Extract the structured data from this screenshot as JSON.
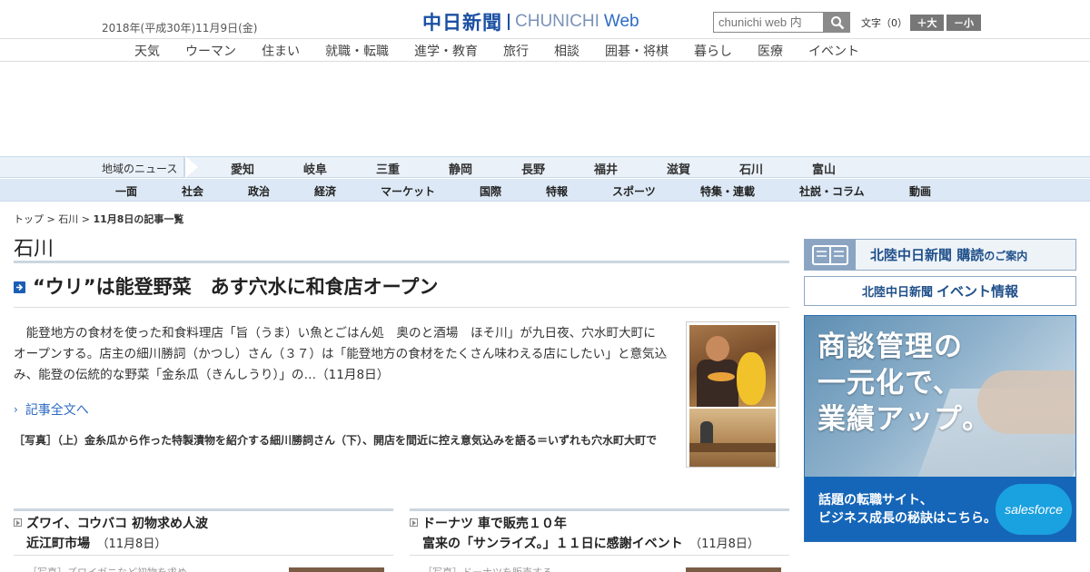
{
  "header": {
    "date": "2018年(平成30年)11月9日(金)",
    "logo_ja": "中日新聞",
    "logo_en": "CHUNICHI",
    "logo_web": "Web",
    "search_placeholder": "chunichi web 内",
    "textsize_label": "文字（0）",
    "bigger_label": "＋大",
    "smaller_label": "－小"
  },
  "topnav": [
    "天気",
    "ウーマン",
    "住まい",
    "就職・転職",
    "進学・教育",
    "旅行",
    "相談",
    "囲碁・将棋",
    "暮らし",
    "医療",
    "イベント"
  ],
  "region": {
    "label": "地域のニュース",
    "prefs": [
      "愛知",
      "岐阜",
      "三重",
      "静岡",
      "長野",
      "福井",
      "滋賀",
      "石川",
      "富山"
    ]
  },
  "sections": [
    "一面",
    "社会",
    "政治",
    "経済",
    "マーケット",
    "国際",
    "特報",
    "スポーツ",
    "特集・連載",
    "社説・コラム",
    "動画"
  ],
  "breadcrumb": {
    "top": "トップ",
    "sep": " > ",
    "region": "石川",
    "current": "11月8日の記事一覧"
  },
  "page_title": "石川",
  "article": {
    "headline": "“ウリ”は能登野菜　あす穴水に和食店オープン",
    "lead": "　能登地方の食材を使った和食料理店「旨（うま）い魚とごはん処　奥のと酒場　ほそ川」が九日夜、穴水町大町にオープンする。店主の細川勝詞（かつし）さん（３７）は「能登地方の食材をたくさん味わえる店にしたい」と意気込み、能登の伝統的な野菜「金糸瓜（きんしうり）」の…（11月8日）",
    "more_link": "記事全文へ",
    "caption": "［写真］（上）金糸瓜から作った特製漬物を紹介する細川勝詞さん（下）、開店を間近に控え意気込みを語る＝いずれも穴水町大町で"
  },
  "sub_articles": [
    {
      "title1": "ズワイ、コウバコ 初物求め人波",
      "title2": "近江町市場",
      "date": "（11月8日）",
      "teaser": "［写真］ズワイガニなど初物を求め"
    },
    {
      "title1": "ドーナツ 車で販売１０年",
      "title2": "富来の「サンライズ。」１１日に感謝イベント",
      "date": "（11月8日）",
      "teaser": "［写真］ドーナツを販売する"
    }
  ],
  "sidebar": {
    "subscribe_title": "北陸中日新聞",
    "subscribe_sub": "購読",
    "subscribe_tail": "のご案内",
    "event_title": "北陸中日新聞",
    "event_sub": "イベント情報",
    "ad_copy": [
      "商談管理の",
      "一元化で、",
      "業績アップ。"
    ],
    "ad_strip": [
      "話題の転職サイト、",
      "ビジネス成長の秘訣はこちら。"
    ],
    "ad_brand": "salesforce"
  },
  "colors": {
    "accent": "#1a4fa3",
    "link": "#2d6cc4",
    "nav_bg": "#dce8f5"
  }
}
